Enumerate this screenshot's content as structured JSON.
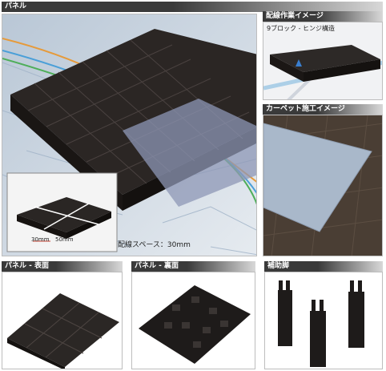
{
  "main": {
    "title": "パネル",
    "spacing_label": "配線スペース：30mm",
    "dim_30": "30mm",
    "dim_50": "50mm"
  },
  "right_top": {
    "title": "配線作業イメージ",
    "subtitle": "9ブロック - ヒンジ構造"
  },
  "right_mid": {
    "title": "カーペット施工イメージ"
  },
  "bottom": {
    "panel_front_title": "パネル - 表面",
    "panel_back_title": "パネル - 裏面",
    "aux_leg_title": "補助脚"
  }
}
